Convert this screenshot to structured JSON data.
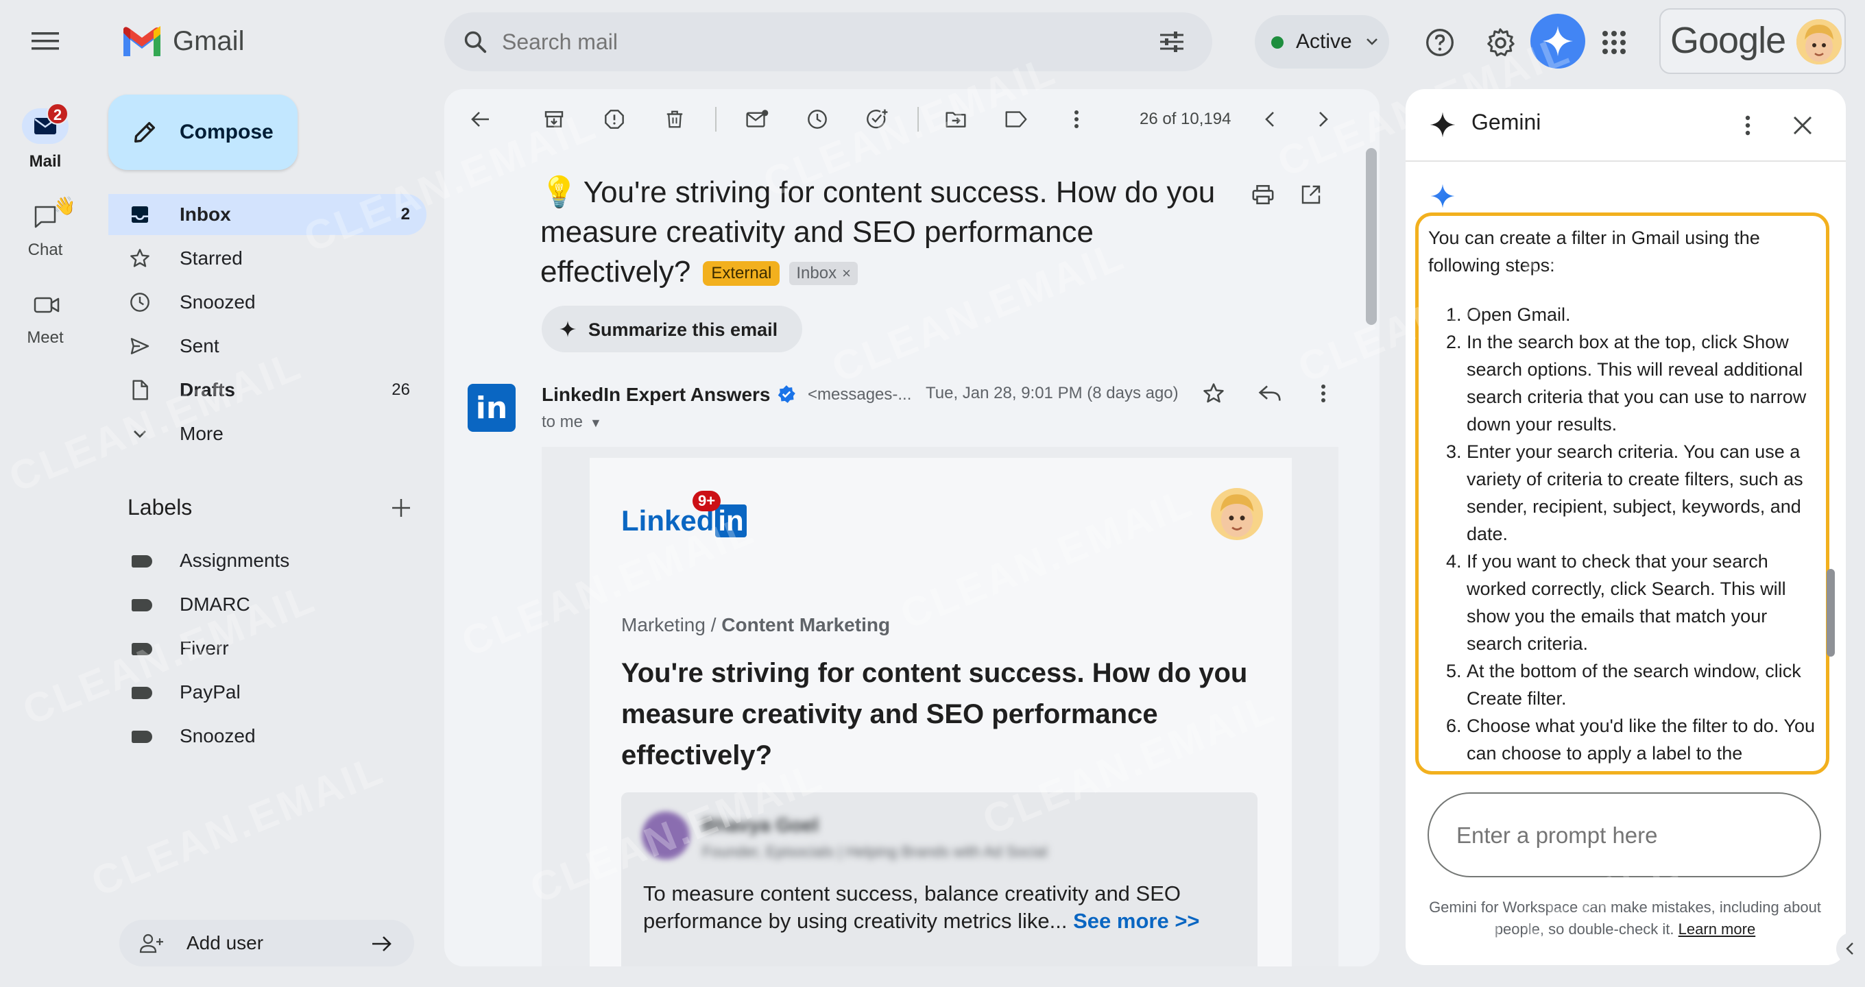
{
  "app": {
    "name": "Gmail",
    "brand_color": "#ea4335"
  },
  "header": {
    "search_placeholder": "Search mail",
    "status_label": "Active",
    "account_logo": "Google"
  },
  "rail": {
    "mail": {
      "label": "Mail",
      "badge": "2"
    },
    "chat": {
      "label": "Chat"
    },
    "meet": {
      "label": "Meet"
    }
  },
  "sidebar": {
    "compose_label": "Compose",
    "nav": [
      {
        "label": "Inbox",
        "count": "2",
        "icon": "inbox-icon"
      },
      {
        "label": "Starred",
        "count": "",
        "icon": "star-icon"
      },
      {
        "label": "Snoozed",
        "count": "",
        "icon": "clock-icon"
      },
      {
        "label": "Sent",
        "count": "",
        "icon": "send-icon"
      },
      {
        "label": "Drafts",
        "count": "26",
        "icon": "draft-icon"
      },
      {
        "label": "More",
        "count": "",
        "icon": "chevron-down-icon"
      }
    ],
    "labels_heading": "Labels",
    "labels": [
      "Assignments",
      "DMARC",
      "Fiverr",
      "PayPal",
      "Snoozed"
    ],
    "add_user_label": "Add user"
  },
  "toolbar": {
    "pagination": "26 of 10,194"
  },
  "email": {
    "subject_emoji": "💡",
    "subject": "You're striving for content success. How do you measure creativity and SEO performance effectively?",
    "tag_external": "External",
    "tag_inbox": "Inbox",
    "summarize_label": "Summarize this email",
    "sender_name": "LinkedIn Expert Answers",
    "sender_email": "<messages-...",
    "date": "Tue, Jan 28, 9:01 PM (8 days ago)",
    "to_line": "to me",
    "body": {
      "logo_text": "Linked",
      "logo_in": "in",
      "notification_badge": "9+",
      "breadcrumb_category": "Marketing",
      "breadcrumb_separator": " / ",
      "breadcrumb_subcategory": "Content Marketing",
      "headline": "You're striving for content success. How do you measure creativity and SEO performance effectively?",
      "answer_name": "Bhavya Goel",
      "answer_title": "Founder, Episocials | Helping Brands with Ad Social",
      "answer_text": "To measure content success, balance creativity and SEO performance by using creativity metrics like...",
      "see_more": "See more >>"
    }
  },
  "gemini": {
    "title": "Gemini",
    "intro": "You can create a filter in Gmail using the following steps:",
    "steps": [
      "Open Gmail.",
      "In the search box at the top, click Show search options. This will reveal additional search criteria that you can use to narrow down your results.",
      "Enter your search criteria. You can use a variety of criteria to create filters, such as sender, recipient, subject, keywords, and date.",
      "If you want to check that your search worked correctly, click Search. This will show you the emails that match your search criteria.",
      "At the bottom of the search window, click Create filter.",
      "Choose what you'd like the filter to do. You can choose to apply a label to the"
    ],
    "prompt_placeholder": "Enter a prompt here",
    "disclaimer": "Gemini for Workspace can make mistakes, including about people, so double-check it.",
    "learn_more": "Learn more",
    "highlight_color": "#f2b01e"
  },
  "watermark_text": "CLEAN.EMAIL"
}
